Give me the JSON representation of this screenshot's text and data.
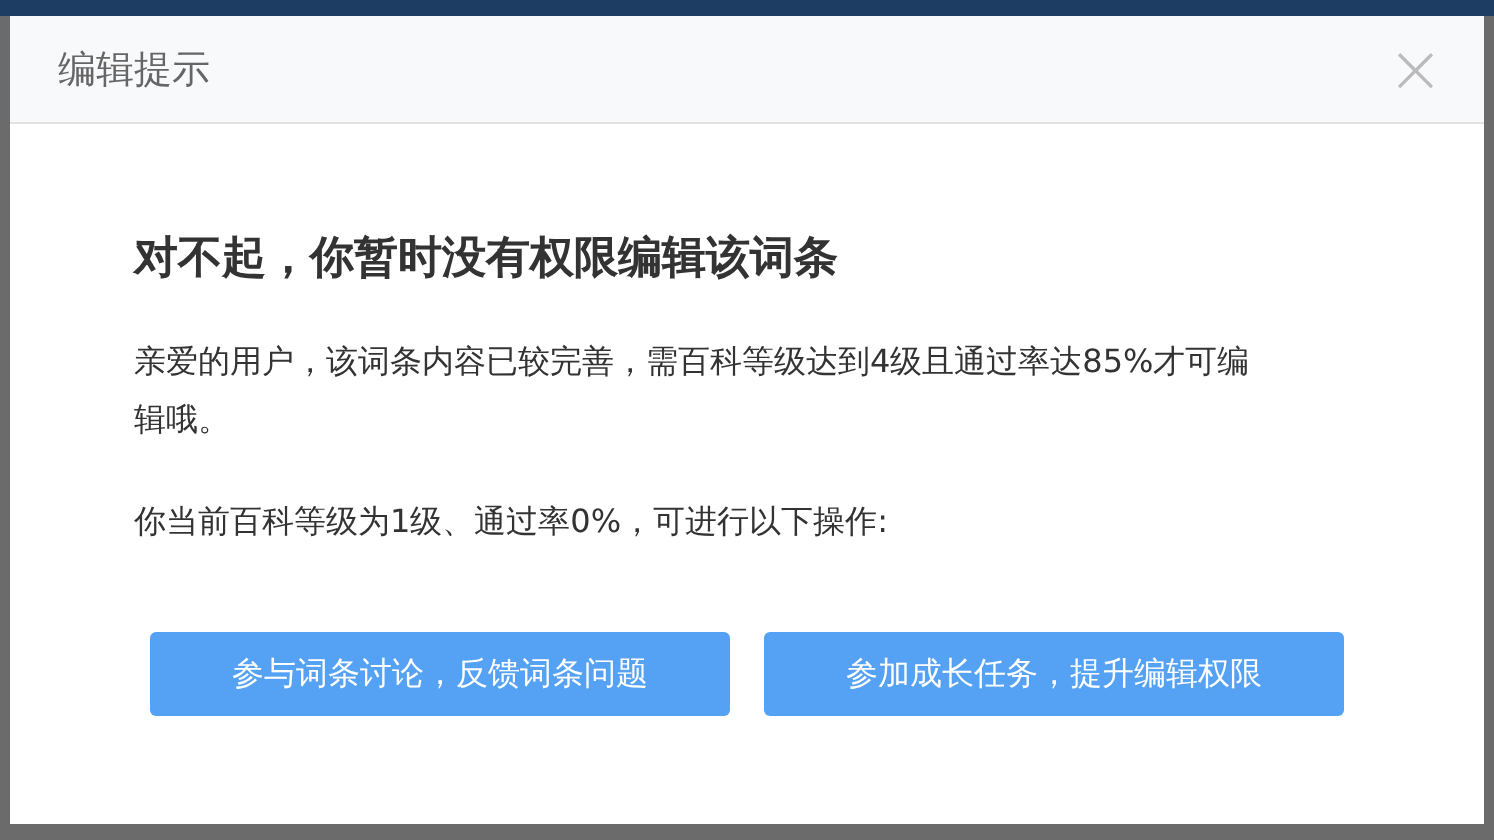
{
  "dialog": {
    "title": "编辑提示",
    "close": "×",
    "heading": "对不起，你暂时没有权限编辑该词条",
    "message": "亲爱的用户，该词条内容已较完善，需百科等级达到4级且通过率达85%才可编辑哦。",
    "status": "你当前百科等级为1级、通过率0%，可进行以下操作:",
    "buttons": [
      "参与词条讨论，反馈词条问题",
      "参加成长任务，提升编辑权限"
    ]
  }
}
